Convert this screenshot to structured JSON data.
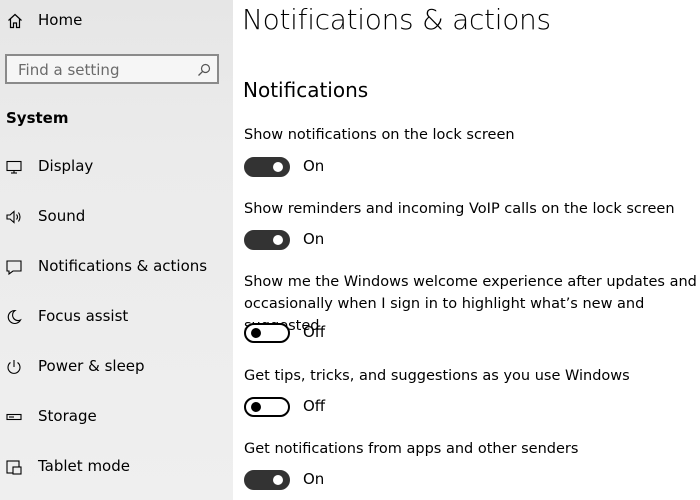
{
  "sidebar": {
    "home_label": "Home",
    "search_placeholder": "Find a setting",
    "section_title": "System",
    "items": [
      {
        "label": "Display",
        "icon": "display-icon"
      },
      {
        "label": "Sound",
        "icon": "speaker-icon"
      },
      {
        "label": "Notifications & actions",
        "icon": "notification-icon"
      },
      {
        "label": "Focus assist",
        "icon": "moon-icon"
      },
      {
        "label": "Power & sleep",
        "icon": "power-icon"
      },
      {
        "label": "Storage",
        "icon": "storage-icon"
      },
      {
        "label": "Tablet mode",
        "icon": "tablet-icon"
      }
    ]
  },
  "main": {
    "title": "Notifications & actions",
    "section_title": "Notifications",
    "settings": [
      {
        "text": "Show notifications on the lock screen",
        "state": "On"
      },
      {
        "text": "Show reminders and incoming VoIP calls on the lock screen",
        "state": "On"
      },
      {
        "text": "Show me the Windows welcome experience after updates and occasionally when I sign in to highlight what’s new and suggested",
        "state": "Off"
      },
      {
        "text": "Get tips, tricks, and suggestions as you use Windows",
        "state": "Off"
      },
      {
        "text": "Get notifications from apps and other senders",
        "state": "On"
      }
    ]
  },
  "colors": {
    "toggle_on": "#333333",
    "toggle_off_border": "#000000",
    "sidebar_bg": "#ebebeb"
  }
}
